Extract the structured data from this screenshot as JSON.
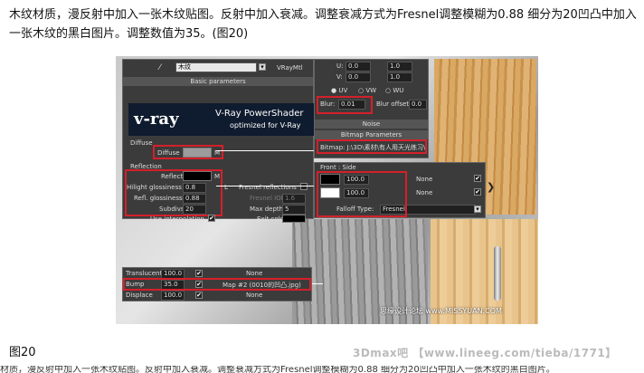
{
  "intro": "木纹材质，漫反射中加入一张木纹贴图。反射中加入衰减。调整衰减方式为Fresnel调整模糊为0.88 细分为20凹凸中加入一张木纹的黑白图片。调整数值为35。(图20)",
  "figure_label": "图20",
  "watermark": "3Dmax吧 【www.lineeg.com/tieba/1771】",
  "cut_text": "材质，漫反射中加入一张木纹贴图。反射中加入衰减。调整衰减方式为Fresnel调整模糊为0.88 细分为20凹凸中加入一张木纹的黑白图片。",
  "site_watermark": "思缘设计论坛  www.MISSYUAN.COM",
  "vray_panel": {
    "material_name": "木纹",
    "material_type": "VRayMtl",
    "basic_params_label": "Basic parameters",
    "logo_text": "v-ray",
    "shader_title": "V-Ray PowerShader",
    "shader_subtitle": "optimized for V-Ray",
    "diffuse_group": "Diffuse",
    "diffuse_label": "Diffuse",
    "map_button": "M",
    "reflection_group": "Reflection",
    "reflect_label": "Reflect",
    "hilight_label": "Hilight glossiness",
    "hilight_value": "0.8",
    "lock_label": "L",
    "refl_gloss_label": "Refl. glossiness",
    "refl_gloss_value": "0.88",
    "subdivs_label": "Subdivs",
    "subdivs_value": "20",
    "use_interp_label": "Use interpolation",
    "fresnel_label": "Fresnel reflections",
    "fresnel_ior_label": "Fresnel IOR",
    "fresnel_ior_value": "1.6",
    "max_depth_label": "Max depth",
    "max_depth_value": "5",
    "exit_color_label": "Exit color"
  },
  "bitmap_panel": {
    "u_label": "U:",
    "u_offset": "0.0",
    "u_tiling": "1.0",
    "v_label": "V:",
    "v_offset": "0.0",
    "v_tiling": "1.0",
    "uv_label": "UV",
    "vw_label": "VW",
    "wu_label": "WU",
    "blur_label": "Blur:",
    "blur_value": "0.01",
    "blur_offset_label": "Blur offset:",
    "blur_offset_value": "0.0",
    "noise_label": "Noise",
    "bitmap_params_label": "Bitmap Parameters",
    "bitmap_path": "Bitmap: J:\\3D\\素材\\有人用天光练习\\木纹\\..."
  },
  "falloff_panel": {
    "front_side_label": "Front : Side",
    "value1": "100.0",
    "value2": "100.0",
    "none1": "None",
    "none2": "None",
    "falloff_type_label": "Falloff Type:",
    "falloff_type_value": "Fresnel"
  },
  "maps_panel": {
    "rows": [
      {
        "name": "Translucent",
        "value": "100.0",
        "map": "None"
      },
      {
        "name": "Bump",
        "value": "35.0",
        "map": "Map #2 (0010的凹凸.jpg)"
      },
      {
        "name": "Displace",
        "value": "100.0",
        "map": "None"
      }
    ]
  }
}
